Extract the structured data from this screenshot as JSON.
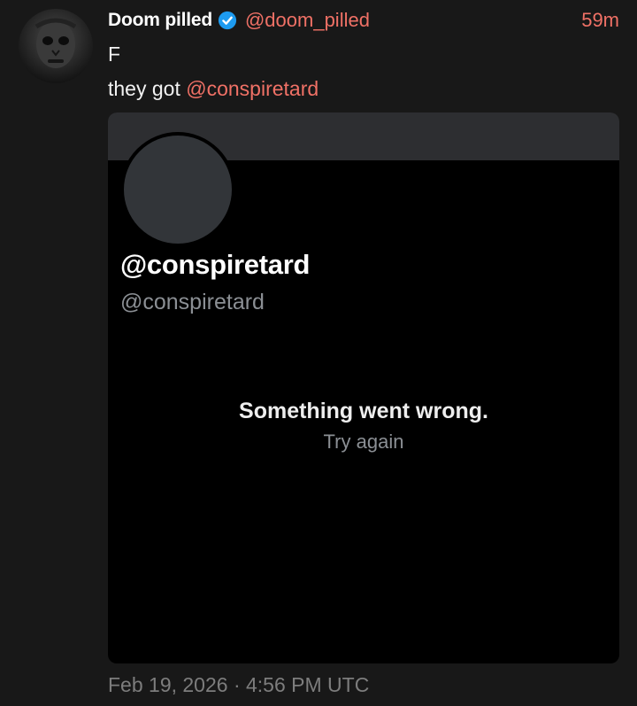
{
  "post": {
    "display_name": "Doom pilled",
    "verified_icon": "verified-badge-icon",
    "handle": "@doom_pilled",
    "time_ago": "59m",
    "line1": "F",
    "line2_prefix": "they got ",
    "line2_mention": "@conspiretard",
    "date": "Feb 19, 2026 · 4:56 PM UTC"
  },
  "embed": {
    "name": "@conspiretard",
    "handle": "@conspiretard",
    "error": "Something went wrong.",
    "retry": "Try again"
  },
  "colors": {
    "background": "#181818",
    "accent": "#f07166",
    "verified": "#1d9bf0",
    "embed_bg": "#000000",
    "muted": "#8b8f94"
  }
}
